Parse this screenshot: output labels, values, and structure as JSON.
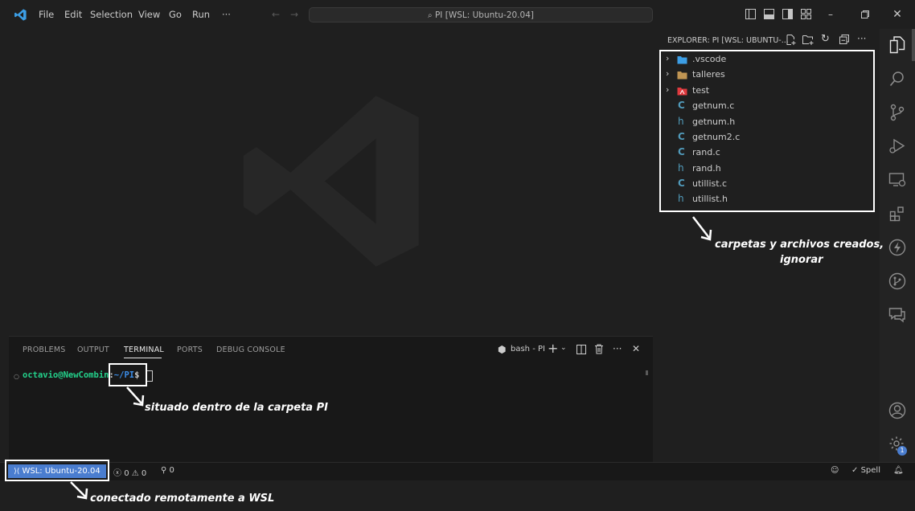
{
  "titlebar": {
    "menu": [
      "File",
      "Edit",
      "Selection",
      "View",
      "Go",
      "Run"
    ],
    "more": "···",
    "search_text": "PI [WSL: Ubuntu-20.04]"
  },
  "panel": {
    "tabs": [
      "PROBLEMS",
      "OUTPUT",
      "TERMINAL",
      "PORTS",
      "DEBUG CONSOLE"
    ],
    "active_tab": "TERMINAL",
    "terminal_name": "bash - PI",
    "prompt_user": "octavio@NewCombin",
    "prompt_sep": ":",
    "prompt_path": "~/PI",
    "prompt_dollar": "$"
  },
  "explorer": {
    "title": "EXPLORER: PI [WSL: UBUNTU-...",
    "items": [
      {
        "name": ".vscode",
        "type": "folder"
      },
      {
        "name": "talleres",
        "type": "folder"
      },
      {
        "name": "test",
        "type": "folder"
      },
      {
        "name": "getnum.c",
        "type": "c"
      },
      {
        "name": "getnum.h",
        "type": "h"
      },
      {
        "name": "getnum2.c",
        "type": "c"
      },
      {
        "name": "rand.c",
        "type": "c"
      },
      {
        "name": "rand.h",
        "type": "h"
      },
      {
        "name": "utillist.c",
        "type": "c"
      },
      {
        "name": "utillist.h",
        "type": "h"
      }
    ]
  },
  "statusbar": {
    "remote": "WSL: Ubuntu-20.04",
    "errors": "0",
    "warnings": "0",
    "ports": "0",
    "spell": "Spell",
    "settings_badge": "1"
  },
  "annotations": {
    "explorer_note_line1": "carpetas y archivos creados,",
    "explorer_note_line2": "ignorar",
    "terminal_note": "situado dentro de la carpeta PI",
    "remote_note": "conectado remotamente a WSL"
  },
  "colors": {
    "accent": "#4a7dcf",
    "prompt_user": "#23d18b",
    "prompt_path": "#3b8eea",
    "c_icon": "#519aba",
    "folder": "#c09553"
  }
}
